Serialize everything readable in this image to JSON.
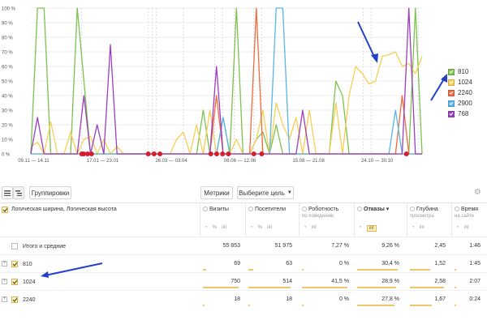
{
  "chart_data": {
    "type": "line",
    "y_ticks": [
      "100 %",
      "90 %",
      "80 %",
      "70 %",
      "60 %",
      "50 %",
      "40 %",
      "30 %",
      "20 %",
      "10 %",
      "0 %"
    ],
    "x_ticks": [
      "09.11 — 14.11",
      "17.01 — 23.01",
      "26.03 — 03.04",
      "06.06 — 12.06",
      "15.08 — 21.08",
      "24.10 — 30.10"
    ],
    "ylim": [
      0,
      100
    ],
    "series": [
      {
        "name": "810",
        "color": "#7cc24d",
        "values": [
          0,
          100,
          100,
          0,
          0,
          0,
          0,
          100,
          50,
          0,
          0,
          0,
          0,
          0,
          0,
          0,
          0,
          0,
          0,
          0,
          0,
          0,
          0,
          0,
          0,
          0,
          30,
          0,
          0,
          25,
          0,
          100,
          0,
          0,
          10,
          15,
          0,
          20,
          0,
          0,
          0,
          0,
          0,
          0,
          0,
          0,
          50,
          40,
          0,
          0,
          0,
          0,
          0,
          0,
          0,
          0,
          0,
          0,
          100,
          0
        ]
      },
      {
        "name": "1024",
        "color": "#f7cf57",
        "values": [
          5,
          8,
          0,
          22,
          0,
          0,
          15,
          0,
          10,
          12,
          0,
          10,
          0,
          5,
          0,
          0,
          0,
          0,
          0,
          0,
          0,
          0,
          10,
          15,
          0,
          20,
          0,
          30,
          0,
          0,
          0,
          10,
          0,
          0,
          10,
          30,
          0,
          35,
          20,
          10,
          25,
          0,
          30,
          0,
          0,
          0,
          35,
          0,
          40,
          60,
          55,
          48,
          50,
          67,
          68,
          70,
          60,
          62,
          55,
          67
        ]
      },
      {
        "name": "2240",
        "color": "#ef6b3c",
        "values": [
          0,
          0,
          0,
          0,
          0,
          0,
          0,
          0,
          0,
          0,
          0,
          0,
          0,
          0,
          0,
          0,
          0,
          0,
          0,
          0,
          0,
          0,
          0,
          0,
          0,
          0,
          0,
          0,
          40,
          0,
          0,
          0,
          0,
          0,
          100,
          0,
          0,
          0,
          0,
          0,
          0,
          0,
          0,
          0,
          0,
          0,
          0,
          0,
          0,
          0,
          0,
          0,
          0,
          0,
          0,
          0,
          40,
          0,
          0,
          0
        ]
      },
      {
        "name": "2900",
        "color": "#58b6e8",
        "values": [
          0,
          0,
          0,
          0,
          0,
          0,
          0,
          0,
          0,
          0,
          0,
          0,
          0,
          0,
          0,
          0,
          0,
          0,
          0,
          0,
          0,
          0,
          0,
          0,
          0,
          0,
          0,
          0,
          0,
          25,
          0,
          0,
          0,
          0,
          0,
          0,
          0,
          100,
          100,
          0,
          0,
          0,
          0,
          0,
          0,
          0,
          0,
          0,
          0,
          0,
          0,
          0,
          0,
          0,
          0,
          30,
          0,
          0,
          0,
          0
        ]
      },
      {
        "name": "768",
        "color": "#9a3fc0",
        "values": [
          0,
          25,
          0,
          0,
          0,
          0,
          0,
          0,
          40,
          0,
          20,
          0,
          75,
          0,
          0,
          0,
          0,
          0,
          0,
          0,
          0,
          0,
          0,
          0,
          0,
          0,
          0,
          0,
          60,
          0,
          0,
          0,
          0,
          0,
          0,
          0,
          0,
          0,
          0,
          0,
          0,
          30,
          0,
          0,
          0,
          0,
          0,
          0,
          0,
          0,
          0,
          0,
          0,
          0,
          0,
          0,
          0,
          100,
          0,
          0
        ]
      }
    ]
  },
  "toolbar": {
    "group_label": "Группировки",
    "metrics_label": "Метрики",
    "goal_label": "Выберите цель"
  },
  "table": {
    "dimension_label": "Логическая ширина, Логическая высота",
    "columns": [
      {
        "label": "Визиты",
        "sub": ""
      },
      {
        "label": "Посетители",
        "sub": ""
      },
      {
        "label": "Роботность",
        "sub": "по поведению"
      },
      {
        "label": "Отказы",
        "sub": ""
      },
      {
        "label": "Глубина",
        "sub": "просмотра"
      },
      {
        "label": "Время",
        "sub": "на сайте"
      }
    ],
    "rows": [
      {
        "label": "Итого и средние",
        "cells": [
          "55 853",
          "51 975",
          "7,27 %",
          "9,26 %",
          "2,45",
          "1:46"
        ]
      },
      {
        "label": "810",
        "cells": [
          "69",
          "63",
          "0 %",
          "30,4 %",
          "1,52",
          "1:45"
        ]
      },
      {
        "label": "1024",
        "cells": [
          "750",
          "514",
          "41,5 %",
          "28,9 %",
          "2,58",
          "2:07"
        ]
      },
      {
        "label": "2240",
        "cells": [
          "18",
          "18",
          "0 %",
          "27,8 %",
          "1,67",
          "0:24"
        ]
      }
    ]
  }
}
